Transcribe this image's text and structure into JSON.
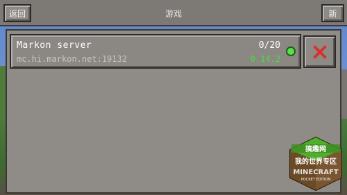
{
  "header": {
    "back_label": "返回",
    "title": "游戏",
    "new_label": "新"
  },
  "server": {
    "name": "Markon server",
    "address": "mc.hi.markon.net:19132",
    "players": "0/20",
    "version": "0.14.2",
    "status": "online"
  },
  "icons": {
    "delete": "close-x-icon",
    "status": "online-status-icon"
  },
  "watermark": {
    "line1": "搞趣网",
    "line2": "我的世界专区",
    "line3": "MINECRAFT",
    "line4": "POCKET EDITION"
  },
  "colors": {
    "version_green": "#3fe23f",
    "delete_red": "#d8312a"
  }
}
